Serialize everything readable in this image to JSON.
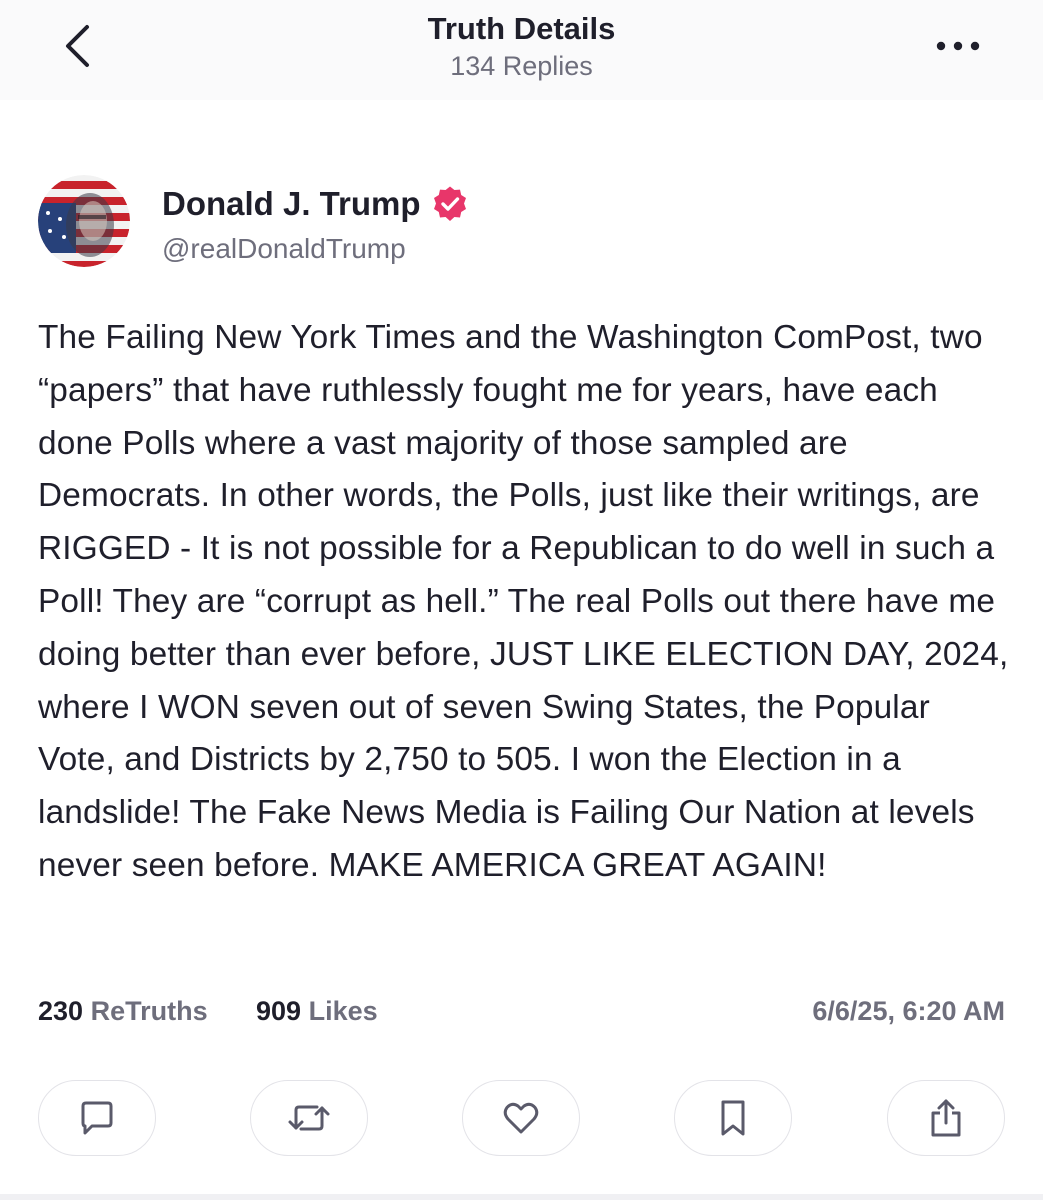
{
  "header": {
    "title": "Truth Details",
    "subtitle": "134 Replies",
    "back_icon": "chevron-left-icon",
    "more_icon": "more-horizontal-icon"
  },
  "author": {
    "name": "Donald J. Trump",
    "handle": "@realDonaldTrump",
    "verified_color": "#e8366a",
    "verified_icon": "verified-badge-icon"
  },
  "post": {
    "text": "The Failing New York Times and the Washington ComPost, two “papers” that have ruthlessly fought me for years, have each done Polls where a vast majority of those sampled are Democrats. In other words, the Polls, just like their writings, are RIGGED - It is not possible for a Republican to do well in such a Poll! They are “corrupt as hell.” The real Polls out there have me doing better than ever before, JUST LIKE ELECTION DAY, 2024, where I WON seven out of seven Swing States, the Popular Vote, and Districts by 2,750 to 505. I won the Election in a landslide! The Fake News Media is Failing Our Nation at levels never seen before. MAKE AMERICA GREAT AGAIN!"
  },
  "stats": {
    "retruths_count": "230",
    "retruths_label": "ReTruths",
    "likes_count": "909",
    "likes_label": "Likes",
    "timestamp": "6/6/25, 6:20 AM"
  },
  "actions": [
    {
      "icon": "reply-icon"
    },
    {
      "icon": "retruth-icon"
    },
    {
      "icon": "like-icon"
    },
    {
      "icon": "bookmark-icon"
    },
    {
      "icon": "share-icon"
    }
  ],
  "colors": {
    "text": "#1f1f2b",
    "muted": "#6e6e7c",
    "accent": "#e8366a",
    "icon": "#5a5a6a"
  }
}
